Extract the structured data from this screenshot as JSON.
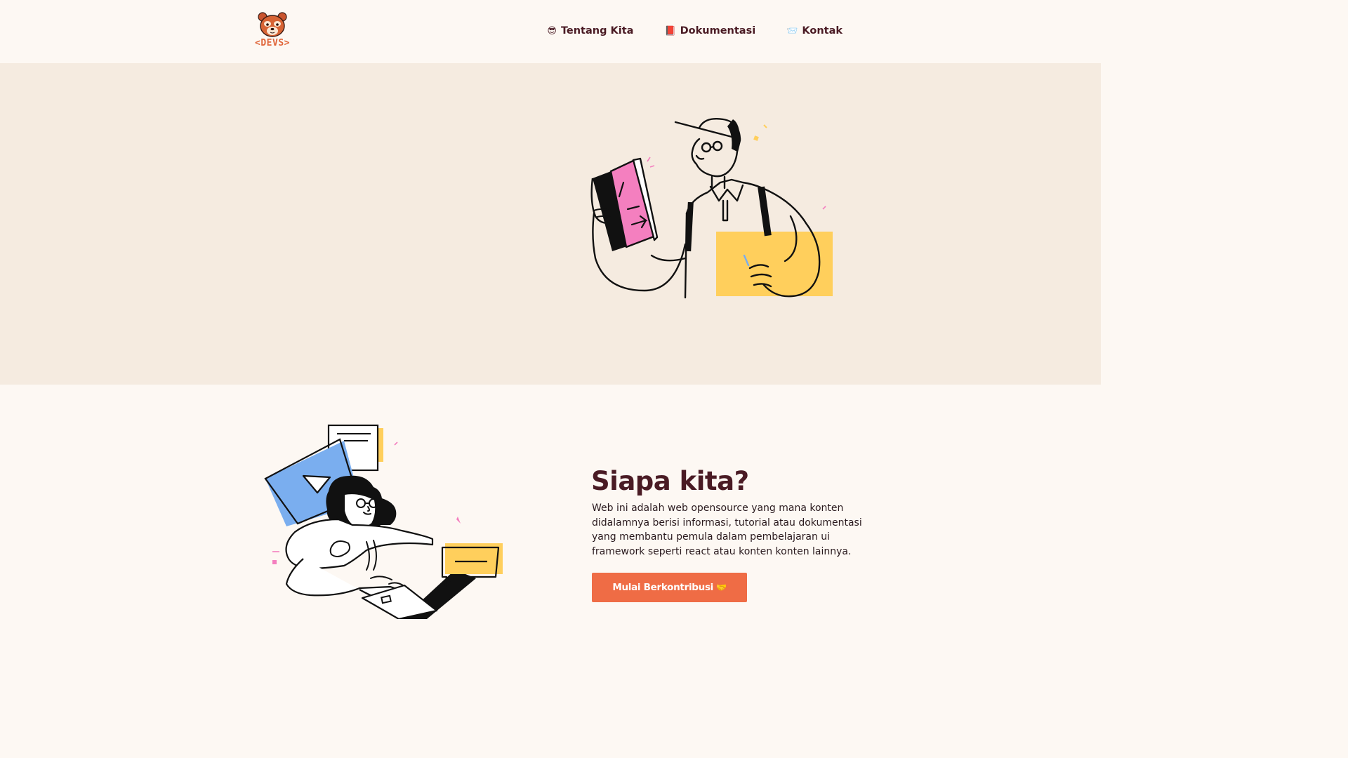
{
  "header": {
    "logo": {
      "text": "<DEVS>",
      "icon": "red-panda-icon"
    },
    "nav": [
      {
        "icon": "😎",
        "icon_name": "sunglasses-face-icon",
        "label": "Tentang Kita"
      },
      {
        "icon": "📕",
        "icon_name": "book-icon",
        "label": "Dokumentasi"
      },
      {
        "icon": "📨",
        "icon_name": "envelope-icon",
        "label": "Kontak"
      }
    ]
  },
  "about": {
    "title": "Siapa kita?",
    "description": "Web ini adalah web opensource yang mana konten didalamnya berisi informasi, tutorial atau dokumentasi yang membantu pemula dalam pembelajaran ui framework seperti react atau konten konten lainnya.",
    "cta_label": "Mulai Berkontribusi",
    "cta_icon": "🤝"
  },
  "colors": {
    "header_bg": "#fdf8f3",
    "hero_bg": "#f5ebe0",
    "accent": "#ef6c45",
    "text_dark": "#4a1b24",
    "pink": "#f47fbf",
    "yellow": "#ffcf5c",
    "blue": "#7aaeef"
  }
}
